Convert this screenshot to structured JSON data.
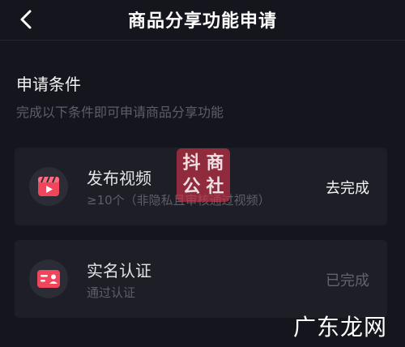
{
  "nav": {
    "back_icon": "chevron-left-icon",
    "title": "商品分享功能申请"
  },
  "section": {
    "title": "申请条件",
    "subtitle": "完成以下条件即可申请商品分享功能"
  },
  "tasks": [
    {
      "icon": "video-clapper-icon",
      "title": "发布视频",
      "subtitle": "≥10个（非隐私且审核通过视频）",
      "action": "去完成",
      "status": "todo"
    },
    {
      "icon": "id-card-icon",
      "title": "实名认证",
      "subtitle": "通过认证",
      "action": "已完成",
      "status": "done"
    }
  ],
  "stamp_chars": [
    "抖",
    "商",
    "公",
    "社"
  ],
  "watermark": "广东龙网",
  "colors": {
    "background": "#15161d",
    "card": "#1d1e26",
    "accent": "#f0465c",
    "muted": "#5d5e68"
  }
}
